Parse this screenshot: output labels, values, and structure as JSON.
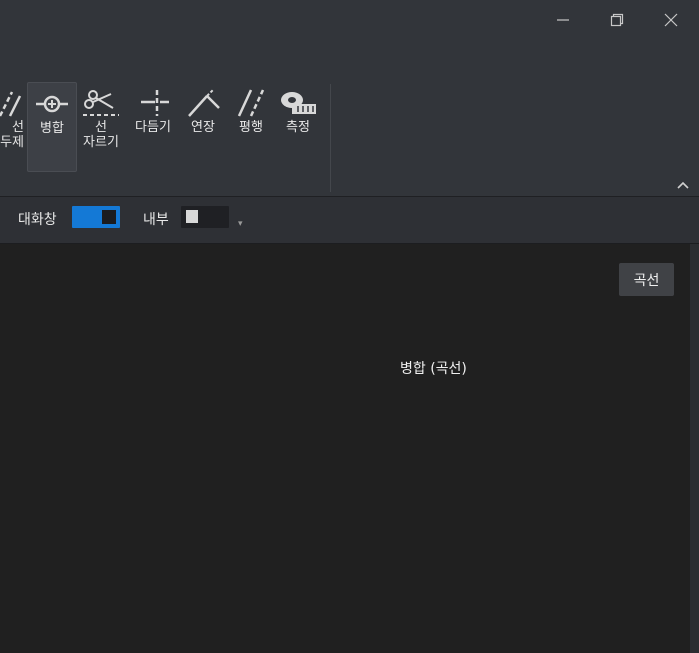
{
  "window": {
    "minimize_icon": "minimize-icon",
    "restore_icon": "restore-icon",
    "close_icon": "close-icon"
  },
  "ribbon": {
    "tools": [
      {
        "label": "선\n두제",
        "icon": "partial-delete-icon",
        "active": false
      },
      {
        "label": "병합",
        "icon": "join-icon",
        "active": true
      },
      {
        "label": "선\n자르기",
        "icon": "scissors-icon",
        "active": false
      },
      {
        "label": "다듬기",
        "icon": "trim-icon",
        "active": false
      },
      {
        "label": "연장",
        "icon": "extend-icon",
        "active": false
      },
      {
        "label": "평행",
        "icon": "parallel-icon",
        "active": false
      },
      {
        "label": "측정",
        "icon": "tape-measure-icon",
        "active": false
      }
    ],
    "collapse_icon": "chevron-up-icon"
  },
  "options": {
    "dialog_label": "대화창",
    "dialog_on": true,
    "inner_label": "내부",
    "inner_on": false
  },
  "canvas": {
    "curve_button": "곡선",
    "status_text": "병합 (곡선)",
    "background": "#202020"
  },
  "colors": {
    "accent": "#1479d6",
    "ribbon_bg": "#32353a"
  }
}
